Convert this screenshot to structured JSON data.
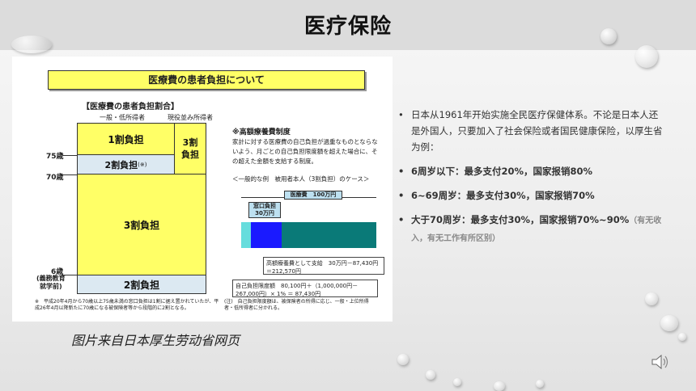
{
  "slide": {
    "title": "医疗保险",
    "caption": "图片来自日本厚生劳动省网页"
  },
  "figure": {
    "header": "医療費の患者負担について",
    "section_title": "【医療費の患者負担割合】",
    "col_general": "一般・低所得者",
    "col_income": "現役並み所得者",
    "boxes": {
      "b1": "1割負担",
      "b3": "3割\n負担",
      "b2": "2割負担",
      "b2_note": "(※)",
      "b30": "3割負担",
      "b20": "2割負担"
    },
    "age_labels": {
      "a75": "75歳",
      "a70": "70歳",
      "a6": "6歳",
      "a6_note": "(義務教育\n就学前)"
    },
    "footnote_left": "※　平成20年4月から70歳以上75歳未満の窓口負担は1割に据え置かれていたが、平成26年4月以降新たに70歳になる被保険者等から段階的に2割となる。",
    "footnote_right": "(注)　自己負担限度額は、被保険者の所得に応じ、一般・上位所得者・低所得者に分かれる。",
    "high_cost": {
      "title": "※高額療養費制度",
      "desc": "家計に対する医療費の自己負担が過重なものとならないよう、月ごとの自己負担限度額を超えた場合に、その超えた金額を支給する制度。",
      "example": "＜一般的な例　被用者本人（3割負担）のケース＞",
      "total": "医療費　100万円",
      "window": "窓口負担\n30万円",
      "refund": "高額療養費として支給　30万円－87,430円＝212,570円",
      "limit": "自己負担限度額　80,100円＋（1,000,000円－267,000円）× 1% ＝ 87,430円"
    }
  },
  "bullets": {
    "b1": "日本从1961年开始实施全民医疗保健体系。不论是日本人还是外国人，只要加入了社会保险或者国民健康保险，以厚生省为例：",
    "b2": "6周岁以下：最多支付20%，国家报销80%",
    "b3": "6~69周岁：最多支付30%，国家报销70%",
    "b4": "大于70周岁：最多支付30%，国家报销70%~90%",
    "b4_note": "（有无收入，有无工作有所区别）"
  },
  "colors": {
    "yellow": "#ffff66",
    "light_blue": "#dce9f2",
    "teal": "#0a7a78",
    "blue": "#1a1aff",
    "cyan": "#66dddd"
  },
  "icons": {
    "speaker": "speaker-icon"
  }
}
